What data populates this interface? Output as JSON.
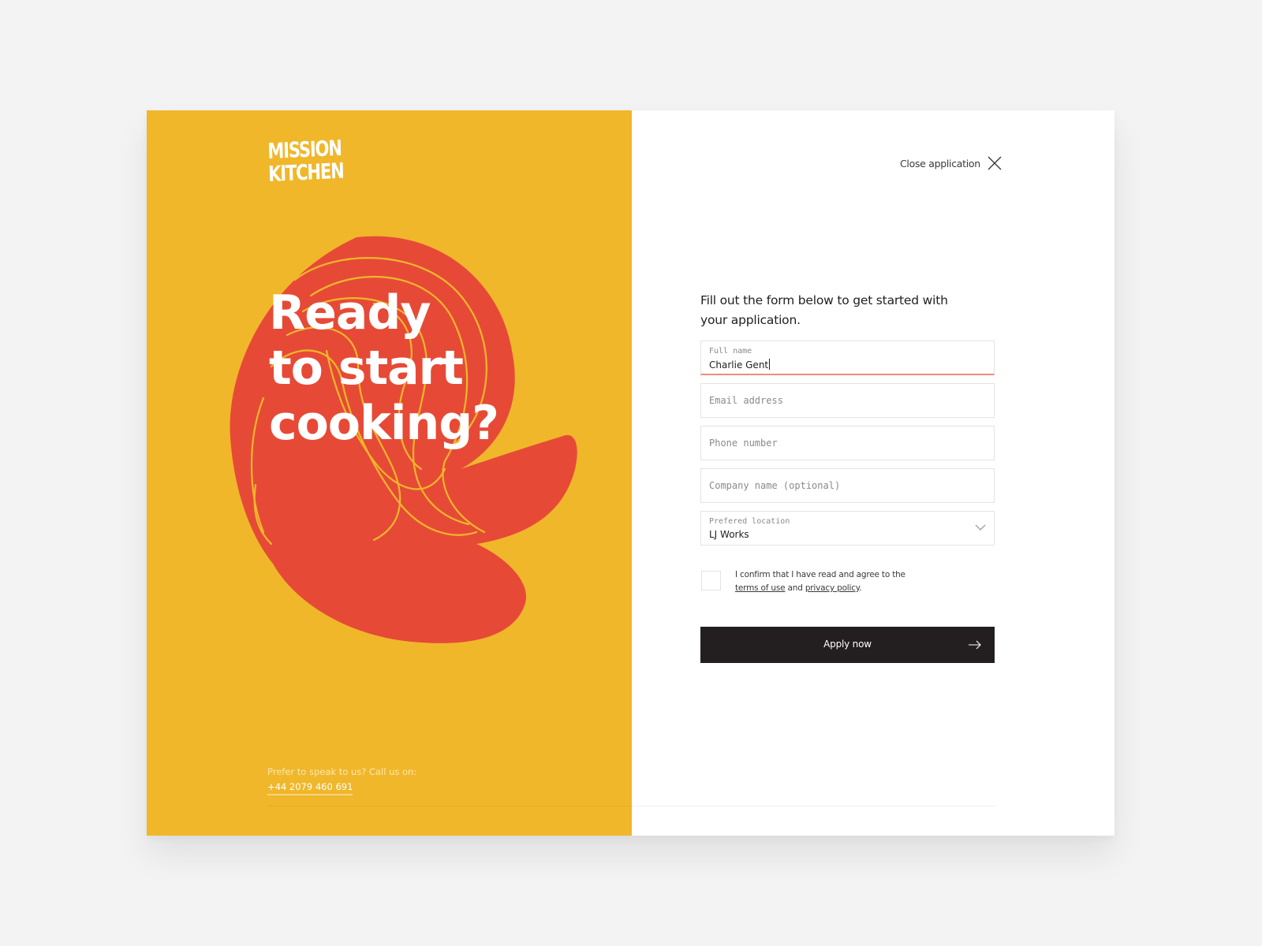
{
  "brand": {
    "logo_line1": "MISSION",
    "logo_line2": "KITCHEN",
    "colors": {
      "panel_yellow": "#f0b72a",
      "blob_red": "#e64a37",
      "button_dark": "#231f20",
      "active_underline": "#e8907e",
      "background": "#f3f3f3"
    }
  },
  "hero": {
    "line1": "Ready",
    "line2": "to start",
    "line3": "cooking?"
  },
  "contact": {
    "prompt": "Prefer to speak to us? Call us on:",
    "phone": "+44 2079 460 691"
  },
  "header": {
    "close_label": "Close application",
    "close_icon": "close-icon"
  },
  "form": {
    "intro": "Fill out the form below to get started with your application.",
    "fields": [
      {
        "label": "Full name",
        "value": "Charlie Gent",
        "active": true
      },
      {
        "placeholder": "Email address"
      },
      {
        "placeholder": "Phone number"
      },
      {
        "placeholder": "Company name (optional)"
      },
      {
        "label": "Prefered location",
        "value": "LJ Works",
        "type": "select"
      }
    ],
    "consent": {
      "text_before": "I confirm that I have read and agree to the",
      "terms_link": "terms of use",
      "and": "and",
      "privacy_link": "privacy policy",
      "period": ".",
      "checked": false
    },
    "submit_label": "Apply now",
    "submit_icon": "arrow-right-icon"
  }
}
